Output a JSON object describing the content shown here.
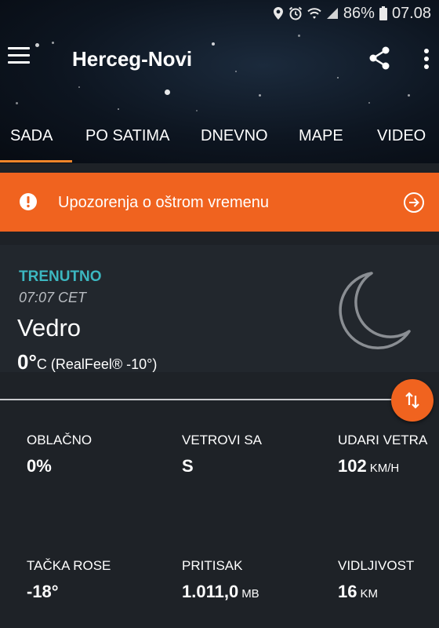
{
  "status_bar": {
    "battery": "86%",
    "time": "07.08"
  },
  "app_bar": {
    "title": "Herceg-Novi"
  },
  "tabs": [
    {
      "label": "SADA",
      "active": true
    },
    {
      "label": "PO SATIMA",
      "active": false
    },
    {
      "label": "DNEVNO",
      "active": false
    },
    {
      "label": "MAPE",
      "active": false
    },
    {
      "label": "VIDEO",
      "active": false
    }
  ],
  "alert": {
    "text": "Upozorenja o oštrom vremenu",
    "color": "#f0631f"
  },
  "current": {
    "label": "TRENUTNO",
    "time": "07:07 CET",
    "condition": "Vedro",
    "temperature": "0°",
    "temp_unit": "C",
    "realfeel": "(RealFeel® -10°)",
    "icon": "moon-icon"
  },
  "details": [
    {
      "label": "OBLAČNO",
      "value": "0%",
      "unit": ""
    },
    {
      "label": "VETROVI SA",
      "value": "S",
      "unit": ""
    },
    {
      "label": "UDARI VETRA",
      "value": "102",
      "unit": "KM/H"
    },
    {
      "label": "TAČKA ROSE",
      "value": "-18°",
      "unit": ""
    },
    {
      "label": "PRITISAK",
      "value": "1.011,0",
      "unit": "MB"
    },
    {
      "label": "VIDLJIVOST",
      "value": "16",
      "unit": "KM"
    }
  ],
  "colors": {
    "accent_orange": "#f0631f",
    "tab_indicator": "#f3862a",
    "label_teal": "#3cb7c0",
    "background": "#1e2227"
  }
}
